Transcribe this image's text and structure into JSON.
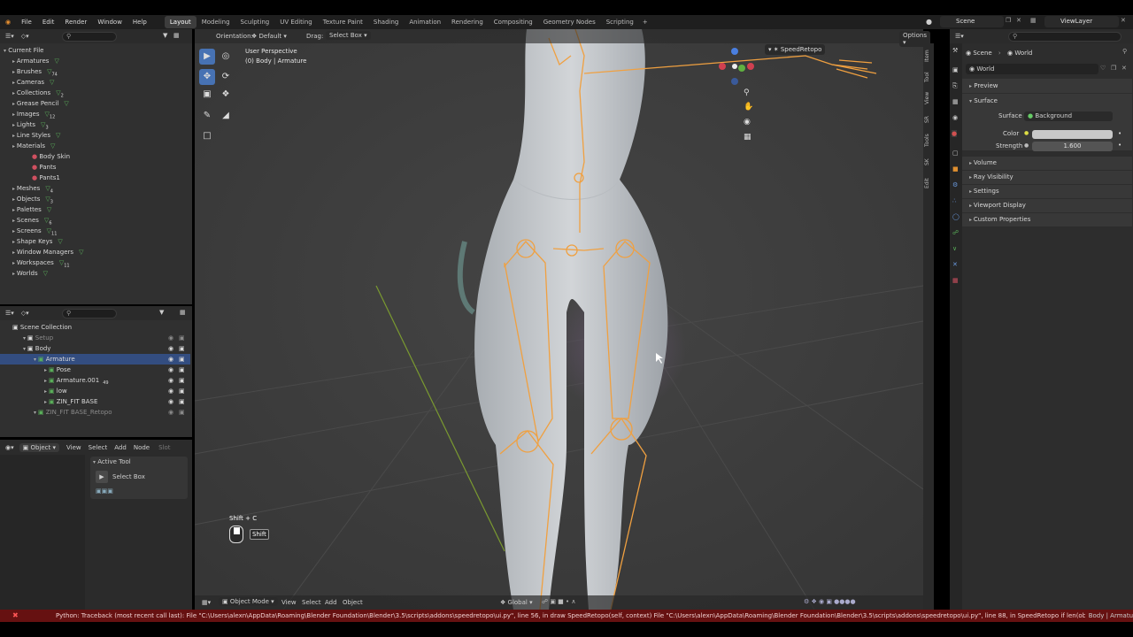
{
  "menu": {
    "file": "File",
    "edit": "Edit",
    "render": "Render",
    "window": "Window",
    "help": "Help"
  },
  "workspaces": [
    {
      "label": "Layout",
      "active": true
    },
    {
      "label": "Modeling"
    },
    {
      "label": "Sculpting"
    },
    {
      "label": "UV Editing"
    },
    {
      "label": "Texture Paint"
    },
    {
      "label": "Shading"
    },
    {
      "label": "Animation"
    },
    {
      "label": "Rendering"
    },
    {
      "label": "Compositing"
    },
    {
      "label": "Geometry Nodes"
    },
    {
      "label": "Scripting"
    }
  ],
  "scene_selector": "Scene",
  "viewlayer_selector": "ViewLayer",
  "outliner_top": {
    "root": "Current File",
    "items": [
      {
        "label": "Armatures",
        "count": ""
      },
      {
        "label": "Brushes",
        "count": "74"
      },
      {
        "label": "Cameras",
        "count": ""
      },
      {
        "label": "Collections",
        "count": "2"
      },
      {
        "label": "Grease Pencil",
        "count": ""
      },
      {
        "label": "Images",
        "count": "12"
      },
      {
        "label": "Lights",
        "count": "3"
      },
      {
        "label": "Line Styles",
        "count": ""
      },
      {
        "label": "Materials",
        "count": ""
      },
      {
        "label": "Body Skin",
        "count": "",
        "child": true
      },
      {
        "label": "Pants",
        "count": "",
        "child": true
      },
      {
        "label": "Pants1",
        "count": "",
        "child": true
      },
      {
        "label": "Meshes",
        "count": "4"
      },
      {
        "label": "Objects",
        "count": "3"
      },
      {
        "label": "Palettes",
        "count": ""
      },
      {
        "label": "Scenes",
        "count": "6"
      },
      {
        "label": "Screens",
        "count": "11"
      },
      {
        "label": "Shape Keys",
        "count": ""
      },
      {
        "label": "Window Managers",
        "count": ""
      },
      {
        "label": "Workspaces",
        "count": "11"
      },
      {
        "label": "Worlds",
        "count": ""
      }
    ]
  },
  "outliner_bottom": {
    "items": [
      {
        "label": "Scene Collection",
        "level": 0
      },
      {
        "label": "Setup",
        "level": 1,
        "dim": true
      },
      {
        "label": "Body",
        "level": 1
      },
      {
        "label": "Armature",
        "level": 2,
        "selected": true
      },
      {
        "label": "Pose",
        "level": 3
      },
      {
        "label": "Armature.001",
        "level": 3,
        "count": "49"
      },
      {
        "label": "low",
        "level": 3
      },
      {
        "label": "ZIN_FIT BASE",
        "level": 3
      },
      {
        "label": "ZIN_FIT BASE_Retopo",
        "level": 2,
        "dim": true
      }
    ]
  },
  "properties_editor": {
    "mode": "Object",
    "view": "View",
    "select": "Select",
    "add": "Add",
    "node": "Node",
    "slot": "Slot",
    "active_tool_title": "Active Tool",
    "active_tool_name": "Select Box"
  },
  "viewport": {
    "orientation_label": "Orientation:",
    "orientation_value": "Default",
    "drag_label": "Drag:",
    "drag_value": "Select Box",
    "options": "Options",
    "perspective": "User Perspective",
    "context": "(0) Body | Armature",
    "speedretopo": "SpeedRetopo",
    "shortcut": "Shift + C",
    "shortcut_key": "Shift",
    "bottom": {
      "mode": "Object Mode",
      "view": "View",
      "select": "Select",
      "add": "Add",
      "object": "Object",
      "transform": "Global"
    },
    "side_tabs": [
      "Item",
      "Tool",
      "View",
      "SR",
      "Tools",
      "SK",
      "Edit"
    ]
  },
  "properties": {
    "breadcrumb_scene": "Scene",
    "breadcrumb_world": "World",
    "world_name": "World",
    "sections": [
      "Preview",
      "Surface",
      "Volume",
      "Ray Visibility",
      "Settings",
      "Viewport Display",
      "Custom Properties"
    ],
    "surface_label": "Surface",
    "surface_value": "Background",
    "color_label": "Color",
    "strength_label": "Strength",
    "strength_value": "1.600",
    "color_hex": "#c8c8c8"
  },
  "status": {
    "message": "Python: Traceback (most recent call last):  File \"C:\\Users\\alexn\\AppData\\Roaming\\Blender Foundation\\Blender\\3.5\\scripts\\addons\\speedretopo\\ui.py\", line 56, in draw    SpeedRetopo(self, context)  File \"C:\\Users\\alexn\\AppData\\Roaming\\Blender Foundation\\Blender\\3.5\\scripts\\addons\\speedretopo\\ui.py\", line 88, in SpeedRetopo    if len(obj.data.polygons)> reference_nbf:AttributeError: 'Armature' o",
    "right": "Body | Armatu"
  },
  "colors": {
    "accent": "#4772b3",
    "bone": "#f0a040",
    "error": "#661111"
  }
}
